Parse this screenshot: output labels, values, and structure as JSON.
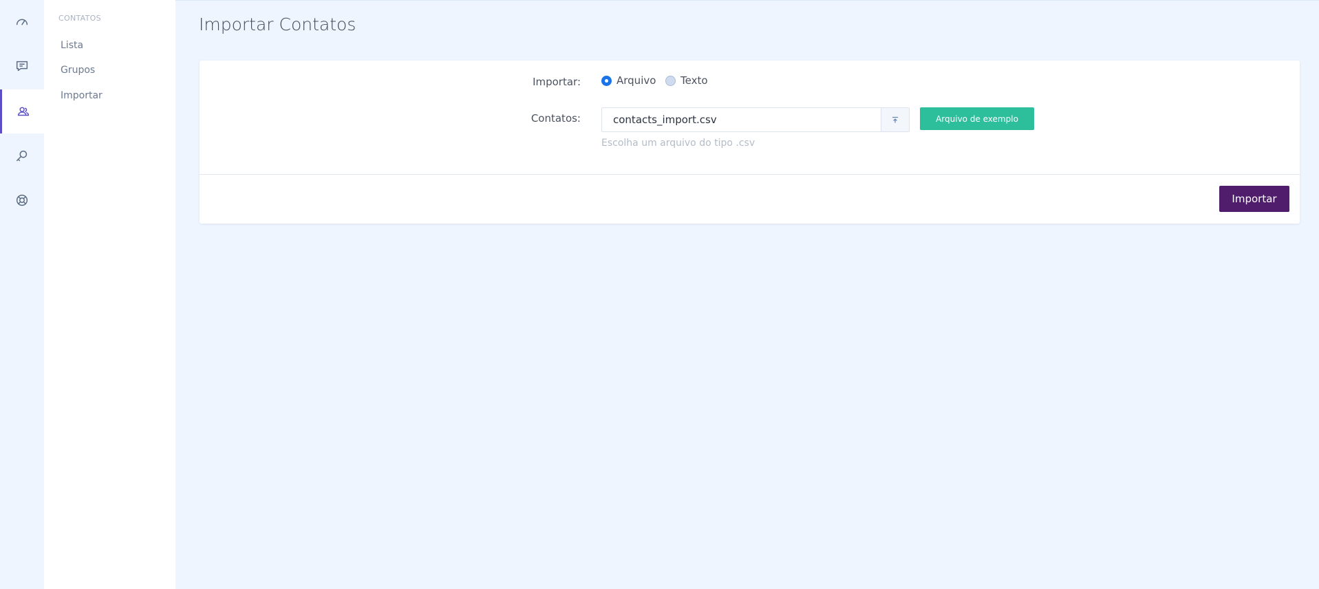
{
  "rail": {
    "items": [
      {
        "icon": "dashboard-gauge-icon"
      },
      {
        "icon": "message-icon"
      },
      {
        "icon": "contacts-icon",
        "active": true
      },
      {
        "icon": "search-key-icon"
      },
      {
        "icon": "support-lifebuoy-icon"
      }
    ]
  },
  "submenu": {
    "heading": "CONTATOS",
    "items": [
      {
        "label": "Lista"
      },
      {
        "label": "Grupos"
      },
      {
        "label": "Importar"
      }
    ]
  },
  "page": {
    "title": "Importar Contatos"
  },
  "form": {
    "import_label": "Importar:",
    "options": [
      {
        "label": "Arquivo",
        "checked": true
      },
      {
        "label": "Texto",
        "checked": false
      }
    ],
    "contacts_label": "Contatos:",
    "file_value": "contacts_import.csv",
    "file_hint": "Escolha um arquivo do tipo .csv",
    "example_button": "Arquivo de exemplo",
    "submit_button": "Importar"
  },
  "colors": {
    "accent": "#5b4fc4",
    "radio_checked": "#1a73e8",
    "example_button": "#2dbe9c",
    "submit_button": "#4f1d6b",
    "background": "#eef5ff"
  }
}
